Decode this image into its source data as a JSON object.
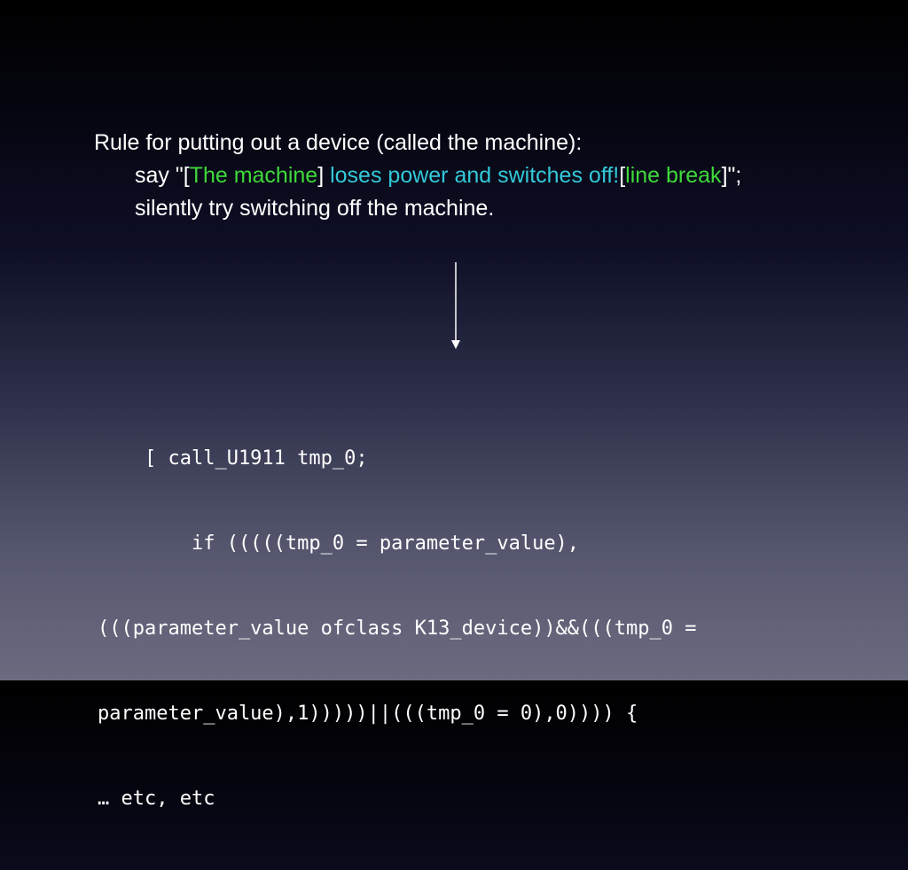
{
  "colors": {
    "text": "#ffffff",
    "green": "#3fd93a",
    "cyan": "#33c9d9"
  },
  "rule": {
    "line1": "Rule for putting out a device (called the machine):",
    "line2": {
      "say": "say \"[",
      "the_machine": "The machine",
      "bracket_close": "]",
      "loses_power": " loses power and switches off!",
      "bracket_open": "[",
      "line_break": "line break",
      "end": "]\";"
    },
    "line3": "silently try switching off the machine."
  },
  "arrow": {
    "icon": "down-arrow-icon"
  },
  "code": {
    "lines": [
      "    [ call_U1911 tmp_0;",
      "        if (((((tmp_0 = parameter_value),",
      "(((parameter_value ofclass K13_device))&&(((tmp_0 =",
      "parameter_value),1)))))||(((tmp_0 = 0),0)))) {",
      "… etc, etc"
    ]
  }
}
